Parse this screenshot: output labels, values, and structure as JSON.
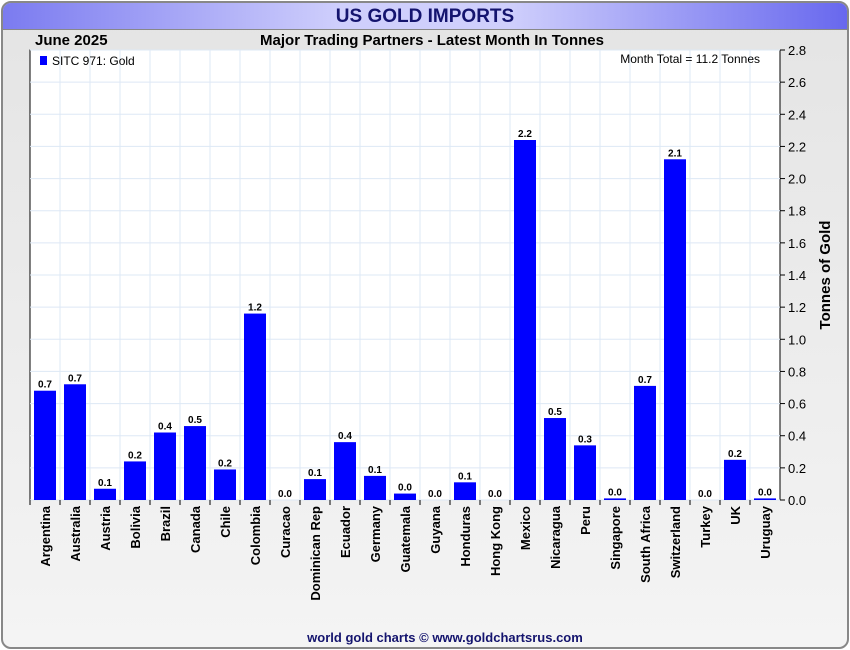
{
  "title": "US GOLD IMPORTS",
  "chart_data": {
    "type": "bar",
    "title": "Major Trading Partners - Latest Month In Tonnes",
    "period": "June 2025",
    "legend": "SITC 971: Gold",
    "legend_placement": "top-left",
    "annotation": "Month Total = 11.2 Tonnes",
    "ylabel": "Tonnes of Gold",
    "xlabel": "",
    "ylim": [
      0,
      2.8
    ],
    "yticks": [
      "0.0",
      "0.2",
      "0.4",
      "0.6",
      "0.8",
      "1.0",
      "1.2",
      "1.4",
      "1.6",
      "1.8",
      "2.0",
      "2.2",
      "2.4",
      "2.6",
      "2.8"
    ],
    "grid": true,
    "bar_color": "#0000ff",
    "categories": [
      "Argentina",
      "Australia",
      "Austria",
      "Bolivia",
      "Brazil",
      "Canada",
      "Chile",
      "Colombia",
      "Curacao",
      "Dominican Rep",
      "Ecuador",
      "Germany",
      "Guatemala",
      "Guyana",
      "Honduras",
      "Hong Kong",
      "Mexico",
      "Nicaragua",
      "Peru",
      "Singapore",
      "South Africa",
      "Switzerland",
      "Turkey",
      "UK",
      "Uruguay"
    ],
    "values": [
      0.68,
      0.72,
      0.07,
      0.24,
      0.42,
      0.46,
      0.19,
      1.16,
      0.0,
      0.13,
      0.36,
      0.15,
      0.04,
      0.0,
      0.11,
      0.0,
      2.24,
      0.51,
      0.34,
      0.01,
      0.71,
      2.12,
      0.0,
      0.25,
      0.01
    ],
    "labels": [
      "0.7",
      "0.7",
      "0.1",
      "0.2",
      "0.4",
      "0.5",
      "0.2",
      "1.2",
      "0.0",
      "0.1",
      "0.4",
      "0.1",
      "0.0",
      "0.0",
      "0.1",
      "0.0",
      "2.2",
      "0.5",
      "0.3",
      "0.0",
      "0.7",
      "2.1",
      "0.0",
      "0.2",
      "0.0"
    ]
  },
  "footer": "world gold charts © www.goldchartsrus.com"
}
